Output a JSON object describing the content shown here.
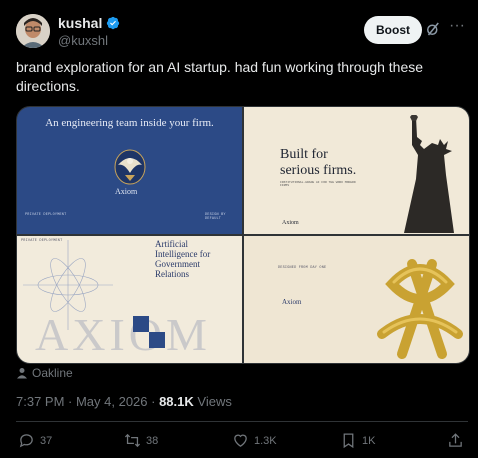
{
  "author": {
    "name": "kushal",
    "handle": "@kuxshl",
    "verified_color": "#1d9bf0"
  },
  "header": {
    "boost_label": "Boost",
    "more_icon": "more-icon",
    "grok_icon": "grok-icon"
  },
  "tweet": {
    "text": "brand exploration for an AI startup. had fun working through these directions."
  },
  "media": {
    "tile1": {
      "headline": "An engineering team inside your firm.",
      "brand": "Axiom",
      "left_caption": "PRIVATE DEPLOYMENT",
      "right_caption": "DESIGN BY DEFAULT",
      "background": "#2c4a86"
    },
    "tile2": {
      "title_line1": "Built for",
      "title_line2": "serious firms.",
      "subtitle": "INSTITUTIONAL-GRADE AI FOR THE WORK MODERN FIRMS",
      "brand": "Axiom"
    },
    "tile3": {
      "title_line1": "Artificial",
      "title_line2": "Intelligence for",
      "title_line3": "Government",
      "title_line4": "Relations",
      "caption": "PRIVATE DEPLOYMENT",
      "watermark": "AXIOM"
    },
    "tile4": {
      "brand": "Axiom",
      "caption": "DESIGNED FROM DAY ONE"
    }
  },
  "meta": {
    "location": "Oakline",
    "time": "7:37 PM · May 4, 2026 · ",
    "views_count": "88.1K",
    "views_label": " Views"
  },
  "actions": {
    "replies": "37",
    "reposts": "38",
    "likes": "1.3K",
    "bookmarks": "1K"
  }
}
